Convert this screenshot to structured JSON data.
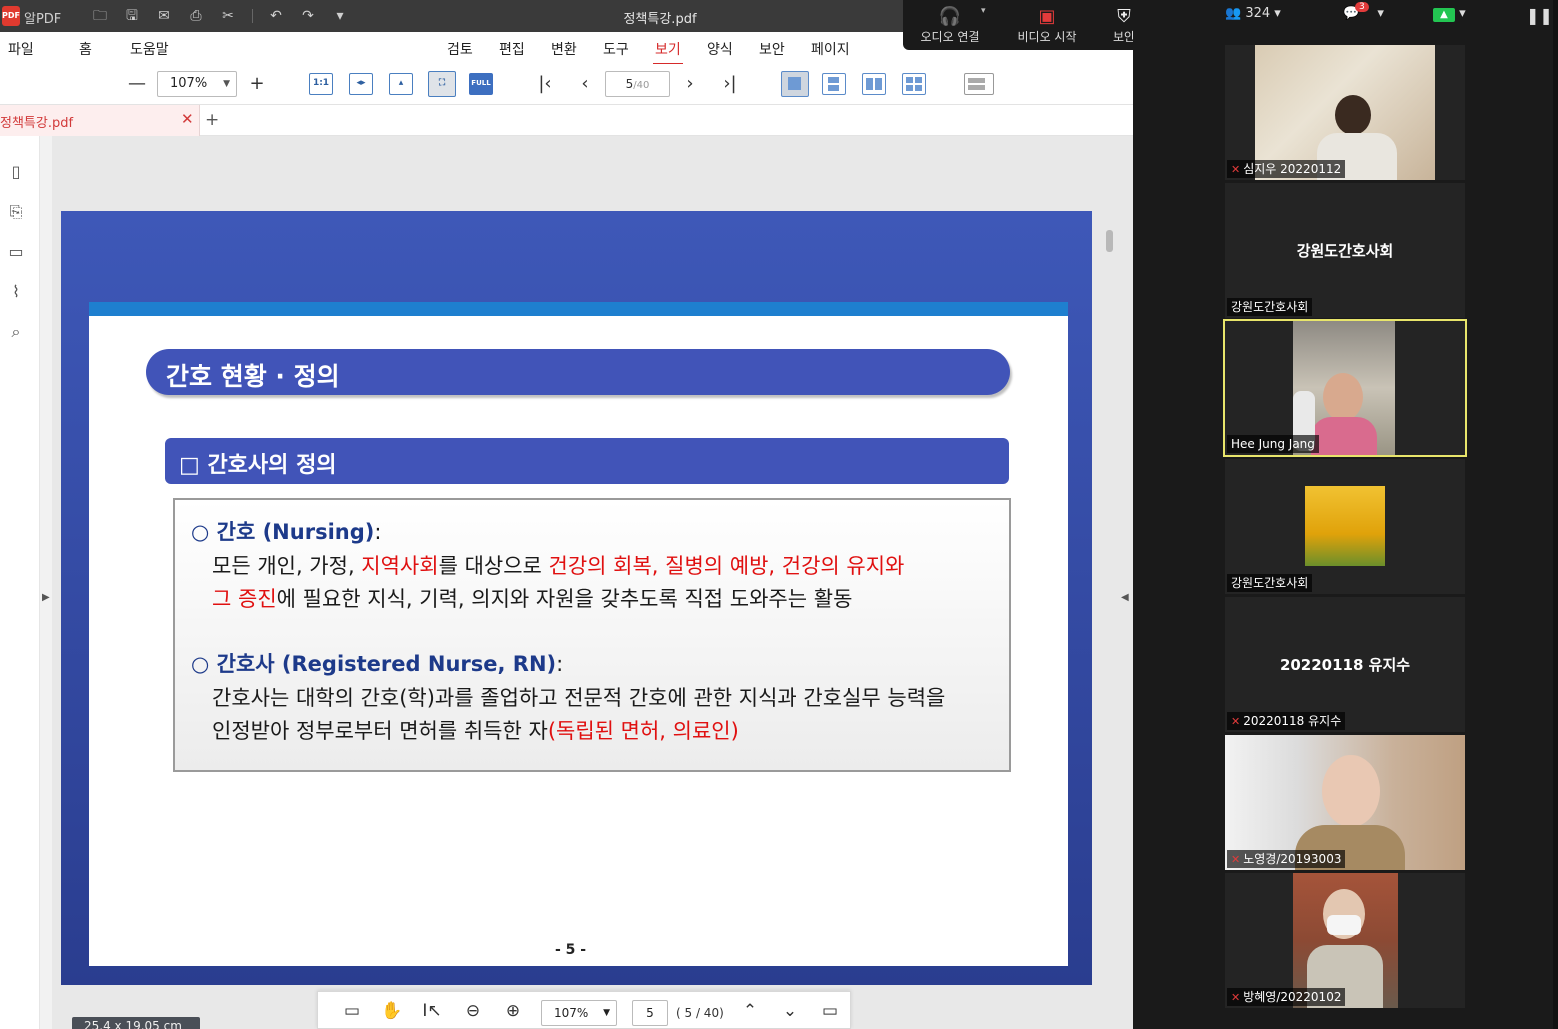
{
  "titlebar": {
    "app_name": "알PDF",
    "logo_text": "PDF",
    "doc_title": "정책특강.pdf"
  },
  "menu": [
    "파일",
    "홈",
    "도움말",
    "검토",
    "편집",
    "변환",
    "도구",
    "보기",
    "양식",
    "보안",
    "페이지"
  ],
  "menu_active": "보기",
  "toolbar": {
    "zoom": "107%",
    "btn_1to1": "1:1",
    "btn_full": "FULL",
    "page_current": "5",
    "page_total": "/40"
  },
  "tab": {
    "label": "정책특강.pdf",
    "close": "✕",
    "add": "+"
  },
  "slide": {
    "title": "간호 현황 · 정의",
    "subtitle": "□ 간호사의 정의",
    "nursing_head": "○ 간호 (Nursing)",
    "colon": ":",
    "line1_a": "모든 개인, 가정, ",
    "line1_red1": "지역사회",
    "line1_b": "를 대상으로 ",
    "line1_red2": "건강의 회복, 질병의 예방, 건강의 유지와",
    "line2_red": "그 증진",
    "line2_b": "에 필요한 지식, 기력, 의지와 자원을 갖추도록 직접 도와주는 활동",
    "rn_head": "○ 간호사 (Registered Nurse, RN)",
    "rn_line1": "간호사는 대학의 간호(학)과를 졸업하고 전문적 간호에 관한 지식과 간호실무 능력을",
    "rn_line2_a": "인정받아 정부로부터 면허를 취득한 자",
    "rn_line2_red": "(독립된 면허, 의료인)",
    "page_num": "- 5 -"
  },
  "bottom_bar": {
    "zoom": "107%",
    "page": "5",
    "total": "( 5 / 40)"
  },
  "size_tag": "25.4 x 19.05 cm",
  "zoom_controls": {
    "audio": "오디오 연결",
    "video": "비디오 시작",
    "security": "보안"
  },
  "zoom_top": {
    "participants": "324",
    "chat_badge": "3"
  },
  "participants": [
    {
      "name": "심지우 20220112",
      "muted": true,
      "type": "video"
    },
    {
      "name": "강원도간호사회",
      "center": "강원도간호사회",
      "muted": false,
      "type": "name"
    },
    {
      "name": "Hee Jung Jang",
      "muted": false,
      "type": "video",
      "active": true
    },
    {
      "name": "강원도간호사회",
      "muted": false,
      "type": "image"
    },
    {
      "name": "20220118 유지수",
      "center": "20220118 유지수",
      "muted": true,
      "type": "name"
    },
    {
      "name": "노영경/20193003",
      "muted": true,
      "type": "video"
    },
    {
      "name": "방혜영/20220102",
      "muted": true,
      "type": "video"
    }
  ],
  "colors": {
    "accent_red": "#d62a2a",
    "slide_blue": "#4154b8",
    "slide_bg": "#3e58b8",
    "active_speaker": "#e8e56b"
  }
}
